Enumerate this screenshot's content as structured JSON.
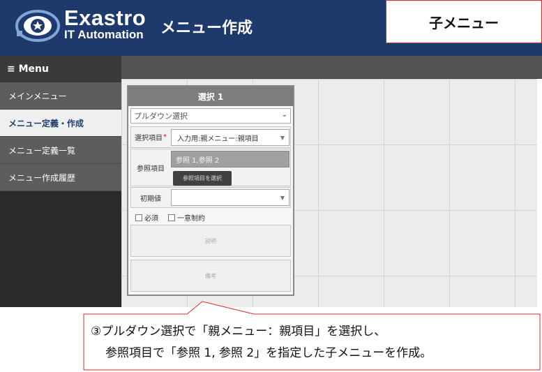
{
  "header": {
    "logo_name": "Exastro",
    "logo_sub": "IT Automation",
    "page_title": "メニュー作成",
    "brand_color": "#1e3a6c"
  },
  "callout_top": {
    "text": "子メニュー"
  },
  "sidebar": {
    "menu_label": "≡ Menu",
    "items": [
      {
        "label": "メインメニュー",
        "active": false
      },
      {
        "label": "メニュー定義・作成",
        "active": true
      },
      {
        "label": "メニュー定義一覧",
        "active": false
      },
      {
        "label": "メニュー作成履歴",
        "active": false
      }
    ]
  },
  "panel": {
    "title": "選択 1",
    "type_select": "プルダウン選択",
    "select_item": {
      "label": "選択項目",
      "required_mark": "*",
      "value": "入力用:親メニュー:親項目"
    },
    "reference": {
      "label": "参照項目",
      "value": "参照 1,参照 2",
      "button": "参照項目を選択"
    },
    "initial": {
      "label": "初期値",
      "value": ""
    },
    "checks": [
      {
        "label": "必須",
        "checked": false
      },
      {
        "label": "一意制約",
        "checked": false
      }
    ],
    "description_placeholder": "説明",
    "remarks_placeholder": "備考"
  },
  "callout_bottom": {
    "line1": "③プルダウン選択で「親メニュー：親項目」を選択し、",
    "line2": "参照項目で「参照 1, 参照 2」を指定した子メニューを作成。",
    "border_color": "#e0272b"
  },
  "icons": {
    "logo": "exastro-logo-icon",
    "type_chevron": "chevron-down-icon",
    "dropdown_arrow": "triangle-down-icon"
  }
}
